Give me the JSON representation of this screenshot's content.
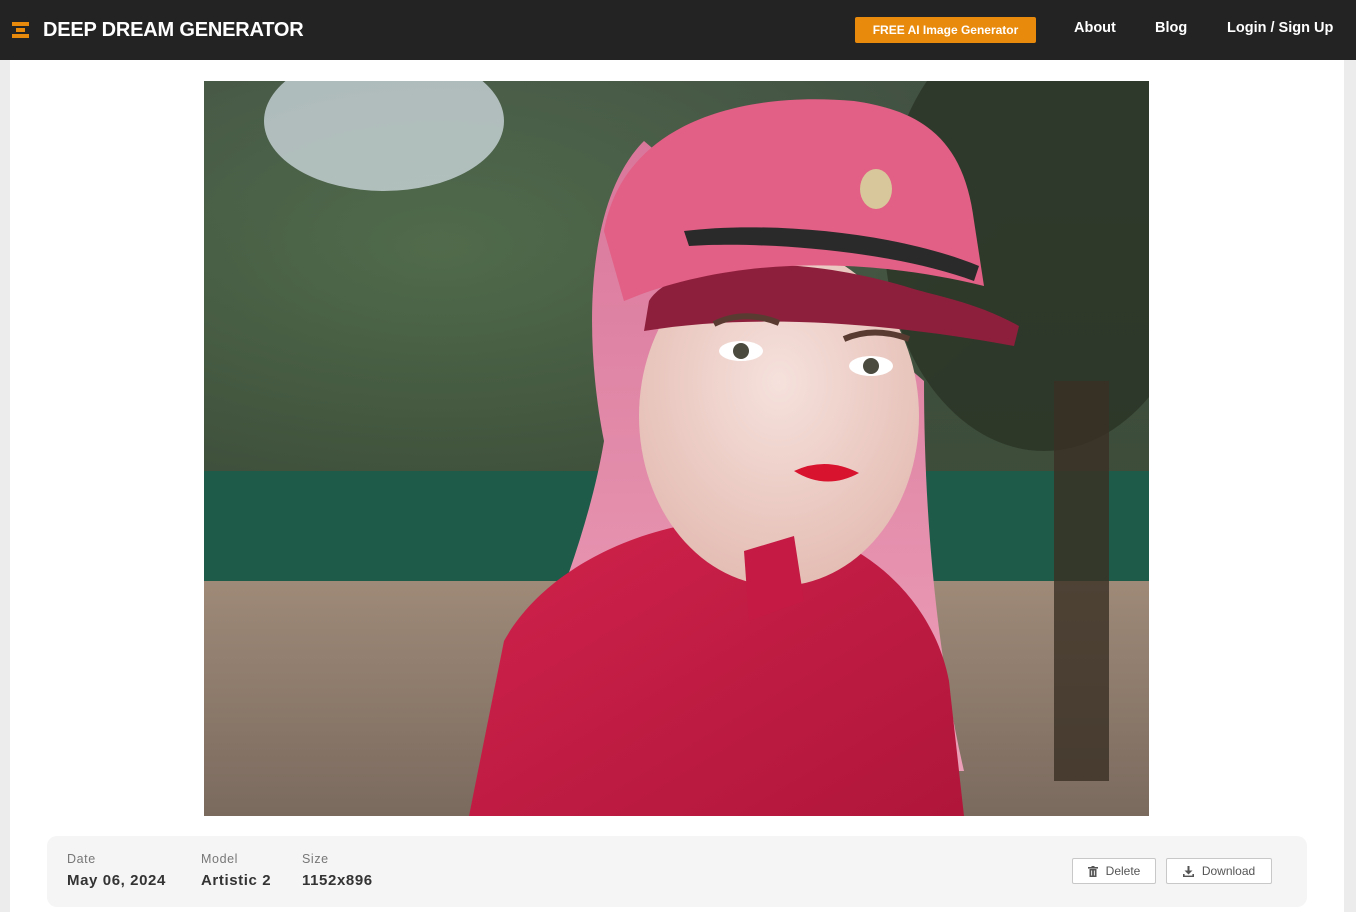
{
  "header": {
    "brand": "DEEP DREAM GENERATOR",
    "logo_icon": "stacked-bars-logo-icon",
    "cta_label": "FREE AI Image Generator",
    "nav": [
      "About",
      "Blog",
      "Login / Sign Up"
    ]
  },
  "image": {
    "alt": "Generated image",
    "subject_icon": "photo"
  },
  "details": {
    "date_label": "Date",
    "date_value": "May 06, 2024",
    "model_label": "Model",
    "model_value": "Artistic 2",
    "size_label": "Size",
    "size_value": "1152x896",
    "delete_label": "Delete",
    "delete_icon": "trash-icon",
    "download_label": "Download",
    "download_icon": "download-icon"
  },
  "colors": {
    "navbar": "#232323",
    "accent": "#e88a0c",
    "background": "#ececec",
    "panel": "#f5f5f5"
  }
}
